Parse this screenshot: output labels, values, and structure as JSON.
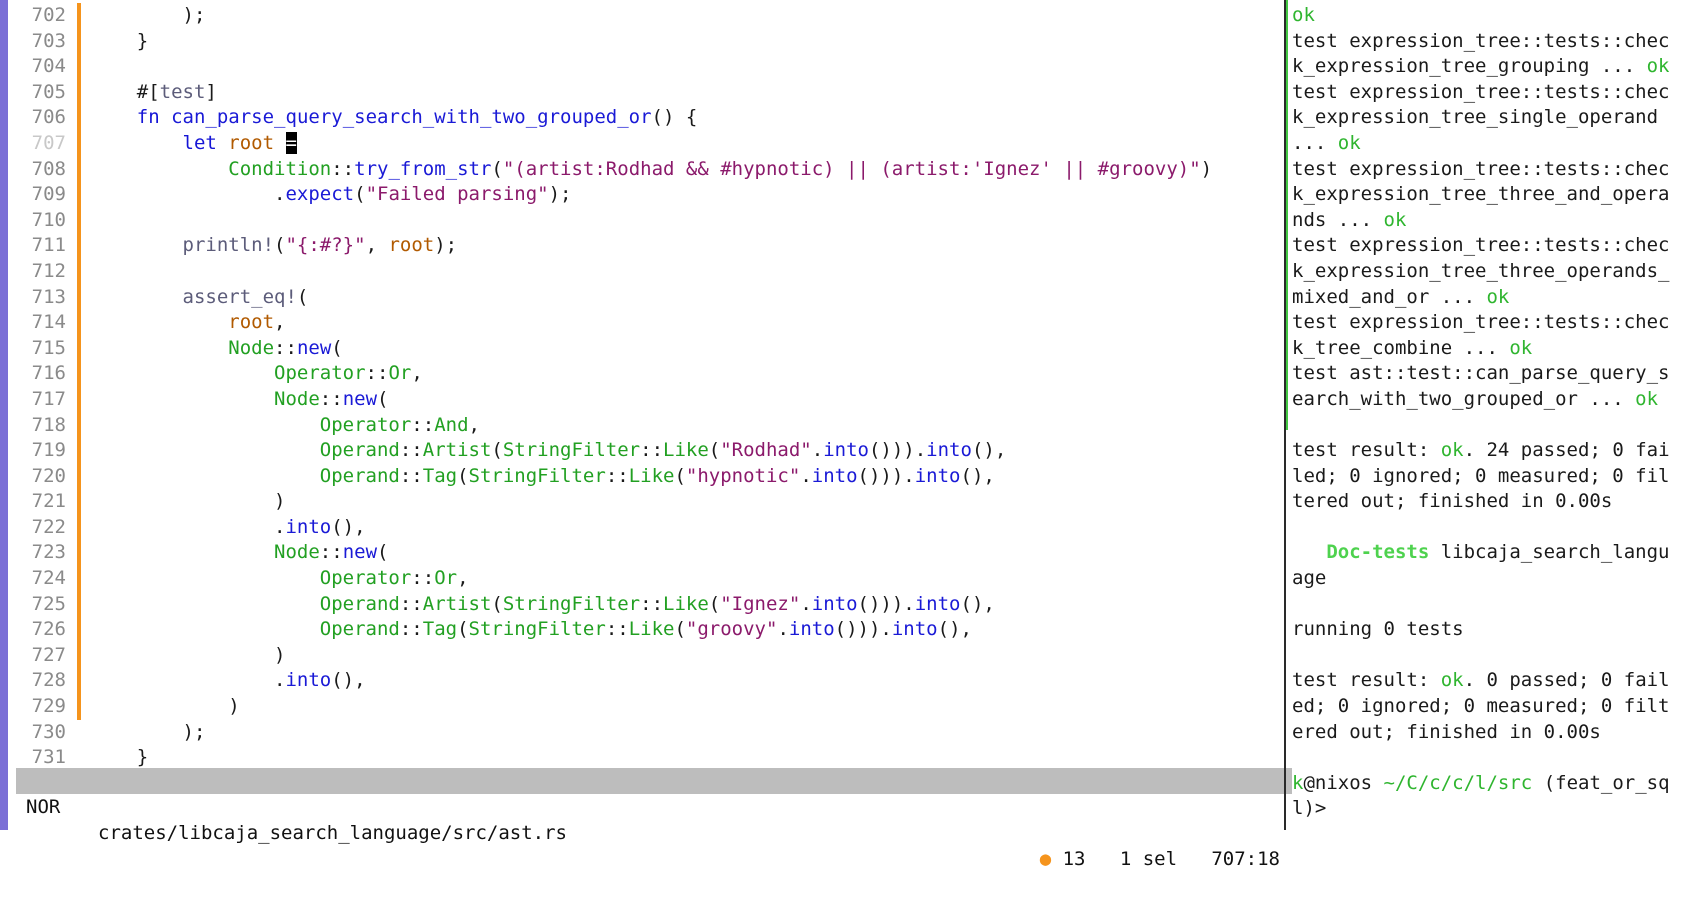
{
  "editor": {
    "lines": [
      {
        "n": "702",
        "mark": true,
        "tokens": [
          [
            "        );",
            ""
          ]
        ]
      },
      {
        "n": "703",
        "mark": true,
        "tokens": [
          [
            "    }",
            ""
          ]
        ]
      },
      {
        "n": "704",
        "mark": true,
        "tokens": []
      },
      {
        "n": "705",
        "mark": true,
        "tokens": [
          [
            "    #[",
            ""
          ],
          [
            "test",
            "attr"
          ],
          [
            "]",
            ""
          ]
        ]
      },
      {
        "n": "706",
        "mark": true,
        "tokens": [
          [
            "    ",
            ""
          ],
          [
            "fn",
            "kw"
          ],
          [
            " ",
            ""
          ],
          [
            "can_parse_query_search_with_two_grouped_or",
            "fn"
          ],
          [
            "() {",
            ""
          ]
        ]
      },
      {
        "n": "707",
        "mark": true,
        "current": true,
        "tokens": [
          [
            "        ",
            ""
          ],
          [
            "let",
            "kw"
          ],
          [
            " ",
            ""
          ],
          [
            "root",
            "var"
          ],
          [
            " ",
            ""
          ],
          [
            "=",
            "cursor"
          ]
        ]
      },
      {
        "n": "708",
        "mark": true,
        "tokens": [
          [
            "            ",
            ""
          ],
          [
            "Condition",
            "ty"
          ],
          [
            "::",
            ""
          ],
          [
            "try_from_str",
            "fn"
          ],
          [
            "(",
            ""
          ],
          [
            "\"(artist:Rodhad && #hypnotic) || (artist:'Ignez' || #groovy)\"",
            "str"
          ],
          [
            ")",
            ""
          ]
        ]
      },
      {
        "n": "709",
        "mark": true,
        "tokens": [
          [
            "                .",
            ""
          ],
          [
            "expect",
            "fn"
          ],
          [
            "(",
            ""
          ],
          [
            "\"Failed parsing\"",
            "str"
          ],
          [
            ");",
            ""
          ]
        ]
      },
      {
        "n": "710",
        "mark": true,
        "tokens": []
      },
      {
        "n": "711",
        "mark": true,
        "tokens": [
          [
            "        ",
            ""
          ],
          [
            "println!",
            "mac"
          ],
          [
            "(",
            ""
          ],
          [
            "\"{:#?}\"",
            "str"
          ],
          [
            ", ",
            ""
          ],
          [
            "root",
            "var"
          ],
          [
            ");",
            ""
          ]
        ]
      },
      {
        "n": "712",
        "mark": true,
        "tokens": []
      },
      {
        "n": "713",
        "mark": true,
        "tokens": [
          [
            "        ",
            ""
          ],
          [
            "assert_eq!",
            "mac"
          ],
          [
            "(",
            ""
          ]
        ]
      },
      {
        "n": "714",
        "mark": true,
        "tokens": [
          [
            "            ",
            ""
          ],
          [
            "root",
            "var"
          ],
          [
            ",",
            ""
          ]
        ]
      },
      {
        "n": "715",
        "mark": true,
        "tokens": [
          [
            "            ",
            ""
          ],
          [
            "Node",
            "ty"
          ],
          [
            "::",
            ""
          ],
          [
            "new",
            "fn"
          ],
          [
            "(",
            ""
          ]
        ]
      },
      {
        "n": "716",
        "mark": true,
        "tokens": [
          [
            "                ",
            ""
          ],
          [
            "Operator",
            "ty"
          ],
          [
            "::",
            ""
          ],
          [
            "Or",
            "ty"
          ],
          [
            ",",
            ""
          ]
        ]
      },
      {
        "n": "717",
        "mark": true,
        "tokens": [
          [
            "                ",
            ""
          ],
          [
            "Node",
            "ty"
          ],
          [
            "::",
            ""
          ],
          [
            "new",
            "fn"
          ],
          [
            "(",
            ""
          ]
        ]
      },
      {
        "n": "718",
        "mark": true,
        "tokens": [
          [
            "                    ",
            ""
          ],
          [
            "Operator",
            "ty"
          ],
          [
            "::",
            ""
          ],
          [
            "And",
            "ty"
          ],
          [
            ",",
            ""
          ]
        ]
      },
      {
        "n": "719",
        "mark": true,
        "tokens": [
          [
            "                    ",
            ""
          ],
          [
            "Operand",
            "ty"
          ],
          [
            "::",
            ""
          ],
          [
            "Artist",
            "ty"
          ],
          [
            "(",
            ""
          ],
          [
            "StringFilter",
            "ty"
          ],
          [
            "::",
            ""
          ],
          [
            "Like",
            "ty"
          ],
          [
            "(",
            ""
          ],
          [
            "\"Rodhad\"",
            "str"
          ],
          [
            ".",
            ""
          ],
          [
            "into",
            "fn"
          ],
          [
            "())).",
            ""
          ],
          [
            "into",
            "fn"
          ],
          [
            "(),",
            ""
          ]
        ]
      },
      {
        "n": "720",
        "mark": true,
        "tokens": [
          [
            "                    ",
            ""
          ],
          [
            "Operand",
            "ty"
          ],
          [
            "::",
            ""
          ],
          [
            "Tag",
            "ty"
          ],
          [
            "(",
            ""
          ],
          [
            "StringFilter",
            "ty"
          ],
          [
            "::",
            ""
          ],
          [
            "Like",
            "ty"
          ],
          [
            "(",
            ""
          ],
          [
            "\"hypnotic\"",
            "str"
          ],
          [
            ".",
            ""
          ],
          [
            "into",
            "fn"
          ],
          [
            "())).",
            ""
          ],
          [
            "into",
            "fn"
          ],
          [
            "(),",
            ""
          ]
        ]
      },
      {
        "n": "721",
        "mark": true,
        "tokens": [
          [
            "                )",
            ""
          ]
        ]
      },
      {
        "n": "722",
        "mark": true,
        "tokens": [
          [
            "                .",
            ""
          ],
          [
            "into",
            "fn"
          ],
          [
            "(),",
            ""
          ]
        ]
      },
      {
        "n": "723",
        "mark": true,
        "tokens": [
          [
            "                ",
            ""
          ],
          [
            "Node",
            "ty"
          ],
          [
            "::",
            ""
          ],
          [
            "new",
            "fn"
          ],
          [
            "(",
            ""
          ]
        ]
      },
      {
        "n": "724",
        "mark": true,
        "tokens": [
          [
            "                    ",
            ""
          ],
          [
            "Operator",
            "ty"
          ],
          [
            "::",
            ""
          ],
          [
            "Or",
            "ty"
          ],
          [
            ",",
            ""
          ]
        ]
      },
      {
        "n": "725",
        "mark": true,
        "tokens": [
          [
            "                    ",
            ""
          ],
          [
            "Operand",
            "ty"
          ],
          [
            "::",
            ""
          ],
          [
            "Artist",
            "ty"
          ],
          [
            "(",
            ""
          ],
          [
            "StringFilter",
            "ty"
          ],
          [
            "::",
            ""
          ],
          [
            "Like",
            "ty"
          ],
          [
            "(",
            ""
          ],
          [
            "\"Ignez\"",
            "str"
          ],
          [
            ".",
            ""
          ],
          [
            "into",
            "fn"
          ],
          [
            "())).",
            ""
          ],
          [
            "into",
            "fn"
          ],
          [
            "(),",
            ""
          ]
        ]
      },
      {
        "n": "726",
        "mark": true,
        "tokens": [
          [
            "                    ",
            ""
          ],
          [
            "Operand",
            "ty"
          ],
          [
            "::",
            ""
          ],
          [
            "Tag",
            "ty"
          ],
          [
            "(",
            ""
          ],
          [
            "StringFilter",
            "ty"
          ],
          [
            "::",
            ""
          ],
          [
            "Like",
            "ty"
          ],
          [
            "(",
            ""
          ],
          [
            "\"groovy\"",
            "str"
          ],
          [
            ".",
            ""
          ],
          [
            "into",
            "fn"
          ],
          [
            "())).",
            ""
          ],
          [
            "into",
            "fn"
          ],
          [
            "(),",
            ""
          ]
        ]
      },
      {
        "n": "727",
        "mark": true,
        "tokens": [
          [
            "                )",
            ""
          ]
        ]
      },
      {
        "n": "728",
        "mark": true,
        "tokens": [
          [
            "                .",
            ""
          ],
          [
            "into",
            "fn"
          ],
          [
            "(),",
            ""
          ]
        ]
      },
      {
        "n": "729",
        "mark": true,
        "tokens": [
          [
            "            )",
            ""
          ]
        ]
      },
      {
        "n": "730",
        "mark": false,
        "tokens": [
          [
            "        );",
            ""
          ]
        ]
      },
      {
        "n": "731",
        "mark": false,
        "tokens": [
          [
            "    }",
            ""
          ]
        ]
      }
    ]
  },
  "statusline": {
    "mode": "NOR",
    "file": "crates/libcaja_search_language/src/ast.rs",
    "dot": "●",
    "diagnostics": "13",
    "selection": "1 sel",
    "position": "707:18"
  },
  "terminal": {
    "lines": [
      [
        [
          "ok",
          "ok"
        ]
      ],
      [
        [
          "test expression_tree::tests::chec",
          ""
        ]
      ],
      [
        [
          "k_expression_tree_grouping ... ",
          ""
        ],
        [
          "ok",
          "ok"
        ]
      ],
      [
        [
          "test expression_tree::tests::chec",
          ""
        ]
      ],
      [
        [
          "k_expression_tree_single_operand",
          ""
        ]
      ],
      [
        [
          "... ",
          ""
        ],
        [
          "ok",
          "ok"
        ]
      ],
      [
        [
          "test expression_tree::tests::chec",
          ""
        ]
      ],
      [
        [
          "k_expression_tree_three_and_opera",
          ""
        ]
      ],
      [
        [
          "nds ... ",
          ""
        ],
        [
          "ok",
          "ok"
        ]
      ],
      [
        [
          "test expression_tree::tests::chec",
          ""
        ]
      ],
      [
        [
          "k_expression_tree_three_operands_",
          ""
        ]
      ],
      [
        [
          "mixed_and_or ... ",
          ""
        ],
        [
          "ok",
          "ok"
        ]
      ],
      [
        [
          "test expression_tree::tests::chec",
          ""
        ]
      ],
      [
        [
          "k_tree_combine ... ",
          ""
        ],
        [
          "ok",
          "ok"
        ]
      ],
      [
        [
          "test ast::test::can_parse_query_s",
          ""
        ]
      ],
      [
        [
          "earch_with_two_grouped_or ... ",
          ""
        ],
        [
          "ok",
          "ok"
        ]
      ],
      [],
      [
        [
          "test result: ",
          ""
        ],
        [
          "ok",
          "ok"
        ],
        [
          ". 24 passed; 0 fai",
          ""
        ]
      ],
      [
        [
          "led; 0 ignored; 0 measured; 0 fil",
          ""
        ]
      ],
      [
        [
          "tered out; finished in 0.00s",
          ""
        ]
      ],
      [],
      [
        [
          "   ",
          ""
        ],
        [
          "Doc-tests",
          "bright"
        ],
        [
          " libcaja_search_langu",
          ""
        ]
      ],
      [
        [
          "age",
          ""
        ]
      ],
      [],
      [
        [
          "running 0 tests",
          ""
        ]
      ],
      [],
      [
        [
          "test result: ",
          ""
        ],
        [
          "ok",
          "ok"
        ],
        [
          ". 0 passed; 0 fail",
          ""
        ]
      ],
      [
        [
          "ed; 0 ignored; 0 measured; 0 filt",
          ""
        ]
      ],
      [
        [
          "ered out; finished in 0.00s",
          ""
        ]
      ],
      [],
      [
        [
          "k",
          "ok"
        ],
        [
          "@nixos ",
          ""
        ],
        [
          "~/C/c/c/l/src",
          "ok"
        ],
        [
          " (feat_or_sq",
          ""
        ]
      ],
      [
        [
          "l)>",
          ""
        ]
      ]
    ]
  }
}
